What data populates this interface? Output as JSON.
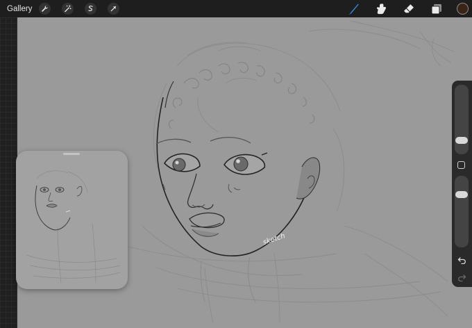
{
  "topbar": {
    "gallery_label": "Gallery",
    "tools_left": [
      "wrench-icon",
      "magic-wand-icon",
      "selection-icon",
      "transform-arrow-icon"
    ],
    "tools_right": [
      "brush-icon",
      "smudge-icon",
      "eraser-icon",
      "layers-icon"
    ],
    "current_color": "#3a2418"
  },
  "canvas": {
    "background": "#9a9a9a",
    "signature_text": "sketch"
  },
  "sidebar": {
    "brush_size_level": 0.15,
    "opacity_level": 0.78
  }
}
